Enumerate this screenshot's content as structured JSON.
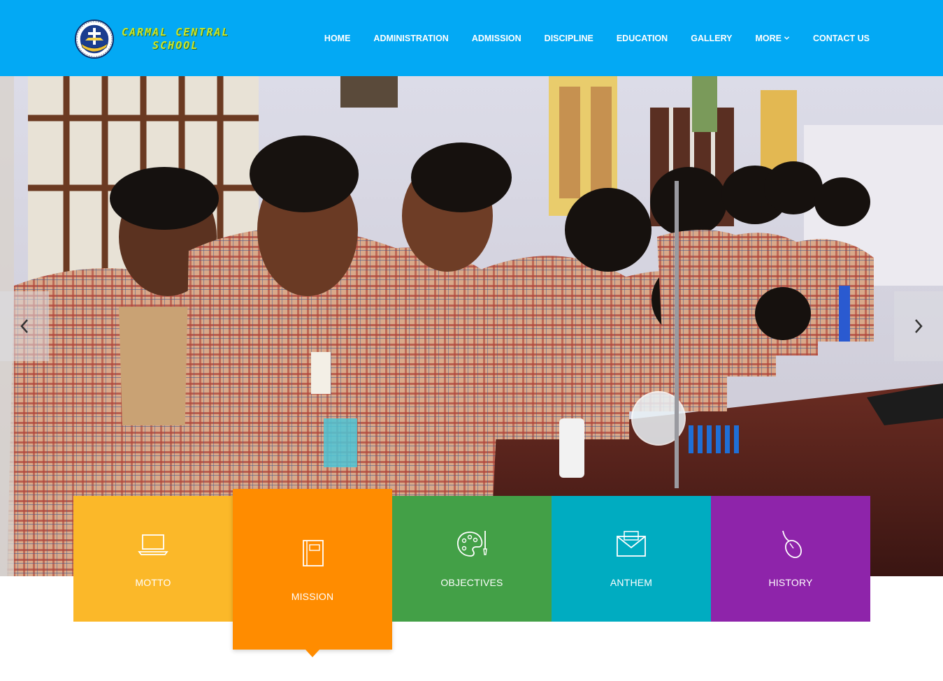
{
  "site": {
    "logo_line1": "CARMAL CENTRAL",
    "logo_line2": "SCHOOL",
    "header_color": "#03a9f4",
    "logo_text_color": "#c9e52b"
  },
  "nav": {
    "items": [
      {
        "label": "HOME"
      },
      {
        "label": "ADMINISTRATION"
      },
      {
        "label": "ADMISSION"
      },
      {
        "label": "DISCIPLINE"
      },
      {
        "label": "EDUCATION"
      },
      {
        "label": "GALLERY"
      },
      {
        "label": "MORE",
        "icon": "chevron-down-icon"
      },
      {
        "label": "CONTACT US"
      }
    ]
  },
  "slider": {
    "prev_icon": "chevron-left-icon",
    "next_icon": "chevron-right-icon"
  },
  "tiles": [
    {
      "label": "MOTTO",
      "icon": "laptop-icon",
      "color": "#fbb829"
    },
    {
      "label": "MISSION",
      "icon": "book-icon",
      "color": "#ff8c00",
      "active": true
    },
    {
      "label": "OBJECTIVES",
      "icon": "palette-icon",
      "color": "#43a047"
    },
    {
      "label": "ANTHEM",
      "icon": "envelope-icon",
      "color": "#00acc1"
    },
    {
      "label": "HISTORY",
      "icon": "mouse-icon",
      "color": "#8e24aa"
    }
  ]
}
